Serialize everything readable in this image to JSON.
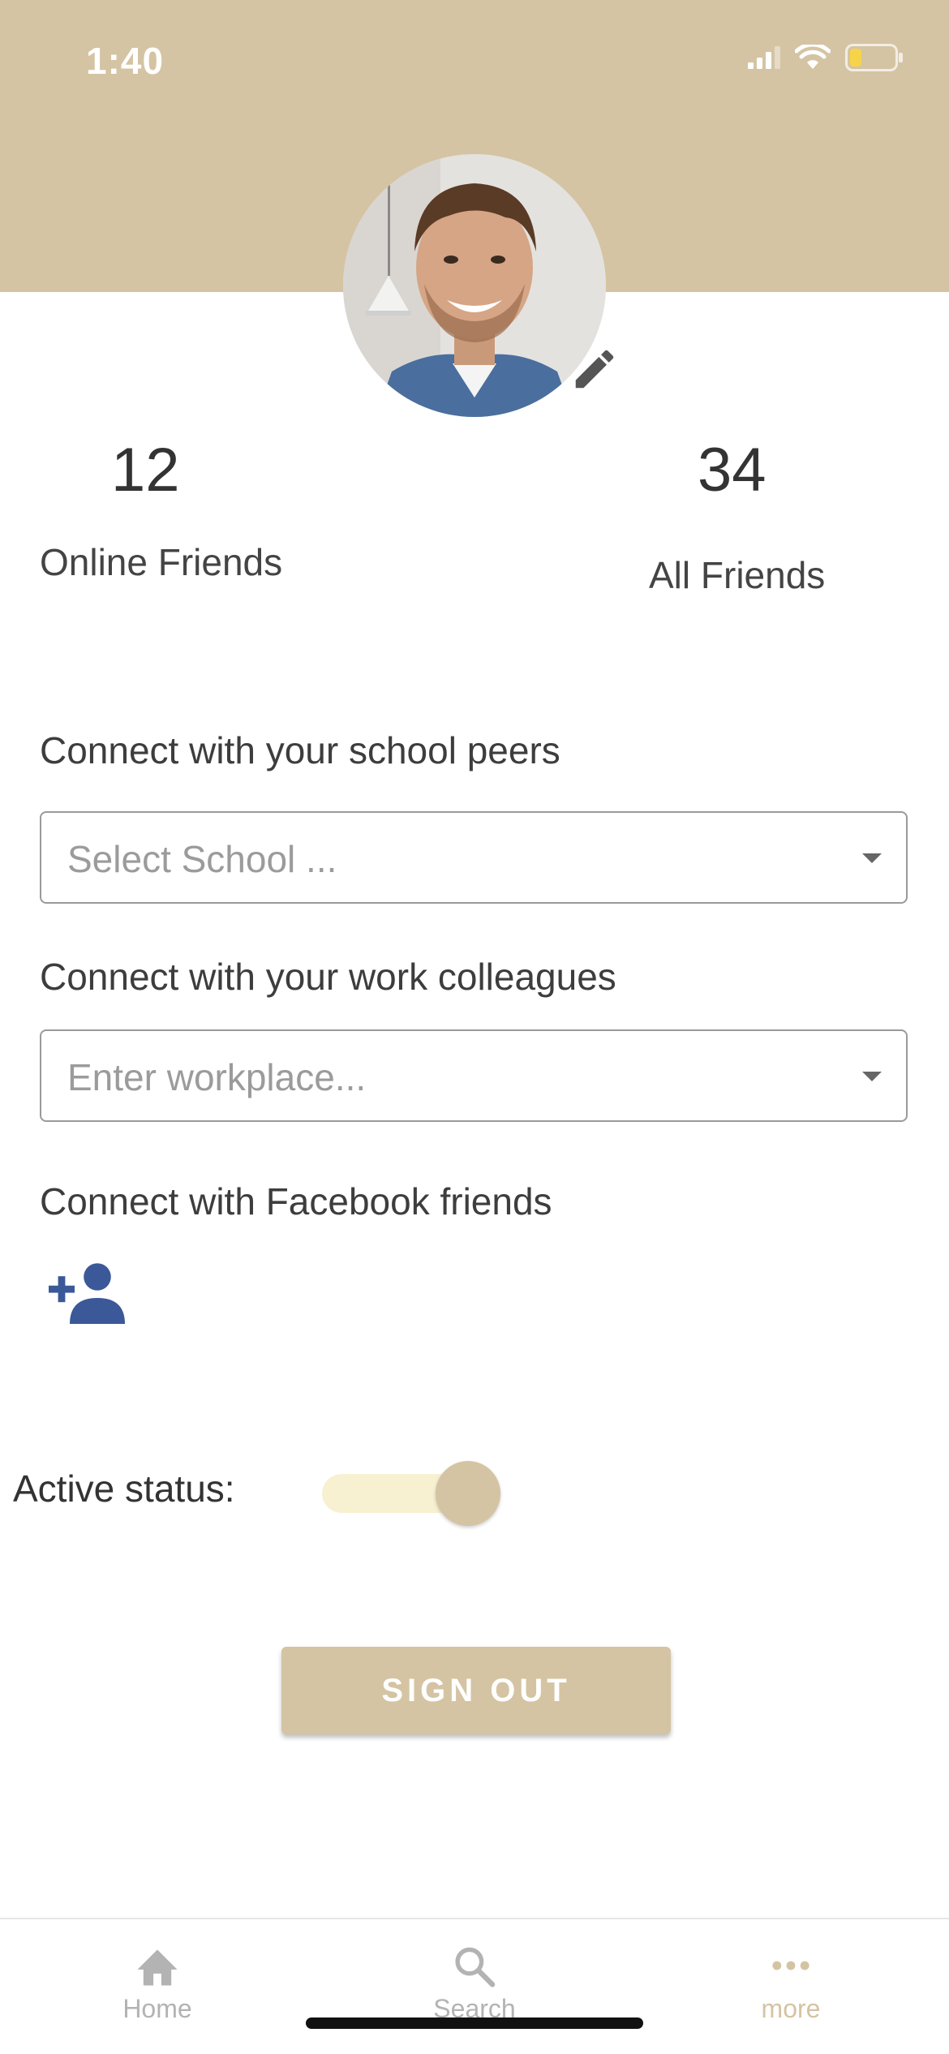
{
  "status_bar": {
    "time": "1:40"
  },
  "profile": {
    "online_friends_count": "12",
    "online_friends_label": "Online Friends",
    "all_friends_count": "34",
    "all_friends_label": "All Friends"
  },
  "school": {
    "label": "Connect with your school peers",
    "placeholder": "Select School ..."
  },
  "work": {
    "label": "Connect with your work colleagues",
    "placeholder": "Enter workplace..."
  },
  "facebook": {
    "label": "Connect with Facebook friends"
  },
  "active_status": {
    "label": "Active status:",
    "enabled": true
  },
  "sign_out_label": "SIGN OUT",
  "tabs": [
    {
      "label": "Home",
      "icon": "home-icon",
      "active": false
    },
    {
      "label": "Search",
      "icon": "search-icon",
      "active": false
    },
    {
      "label": "more",
      "icon": "more-icon",
      "active": true
    }
  ],
  "colors": {
    "accent": "#d4c4a3",
    "facebook_blue": "#3b5998",
    "toggle_track": "#f8f1d1"
  }
}
